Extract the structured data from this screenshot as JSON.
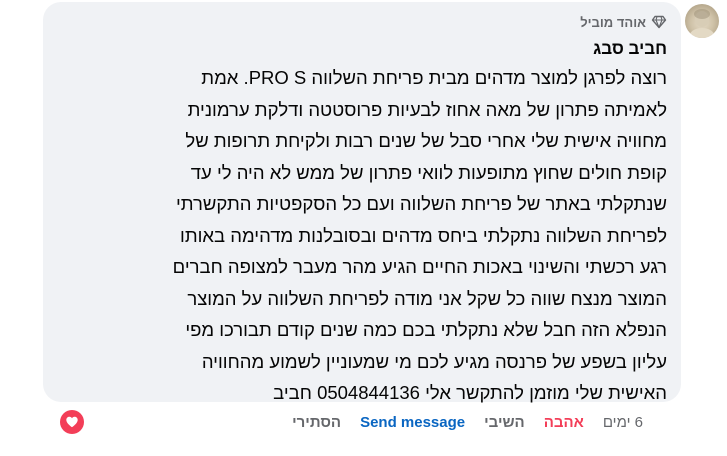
{
  "comment": {
    "badge_label": "אוהד מוביל",
    "badge_icon": "diamond-icon",
    "author_name": "חביב סבג",
    "body_lines": [
      "רוצה לפרגן למוצר מדהים מבית פריחת השלווה PRO S. אמת",
      "לאמיתה פתרון של מאה אחוז לבעיות פרוסטטה ודלקת ערמונית",
      "מחוויה אישית שלי אחרי סבל של שנים רבות ולקיחת תרופות של",
      "קופת חולים שחוץ מתופעות לוואי פתרון של ממש לא היה לי עד",
      "שנתקלתי באתר של פריחת השלווה ועם כל הסקפטיות התקשרתי",
      "לפריחת השלווה נתקלתי ביחס מדהים ובסובלנות מדהימה באותו",
      "רגע רכשתי והשינוי באכות החיים הגיע מהר מעבר למצופה חברים",
      "המוצר מנצח שווה כל שקל אני מודה לפריחת השלווה על המוצר",
      "הנפלא הזה חבל שלא נתקלתי בכם כמה שנים קודם תבורכו מפי",
      "עליון בשפע של פרנסה מגיע לכם מי שמעוניין לשמוע מהחוויה",
      "האישית שלי מוזמן להתקשר אלי 0504844136 חביב"
    ]
  },
  "actions": {
    "time": "6 ימים",
    "love": "אהבה",
    "reply": "השיבי",
    "send_message": "Send message",
    "hide": "הסתירי"
  },
  "reaction": {
    "icon": "heart-icon",
    "color": "#f33e58"
  }
}
